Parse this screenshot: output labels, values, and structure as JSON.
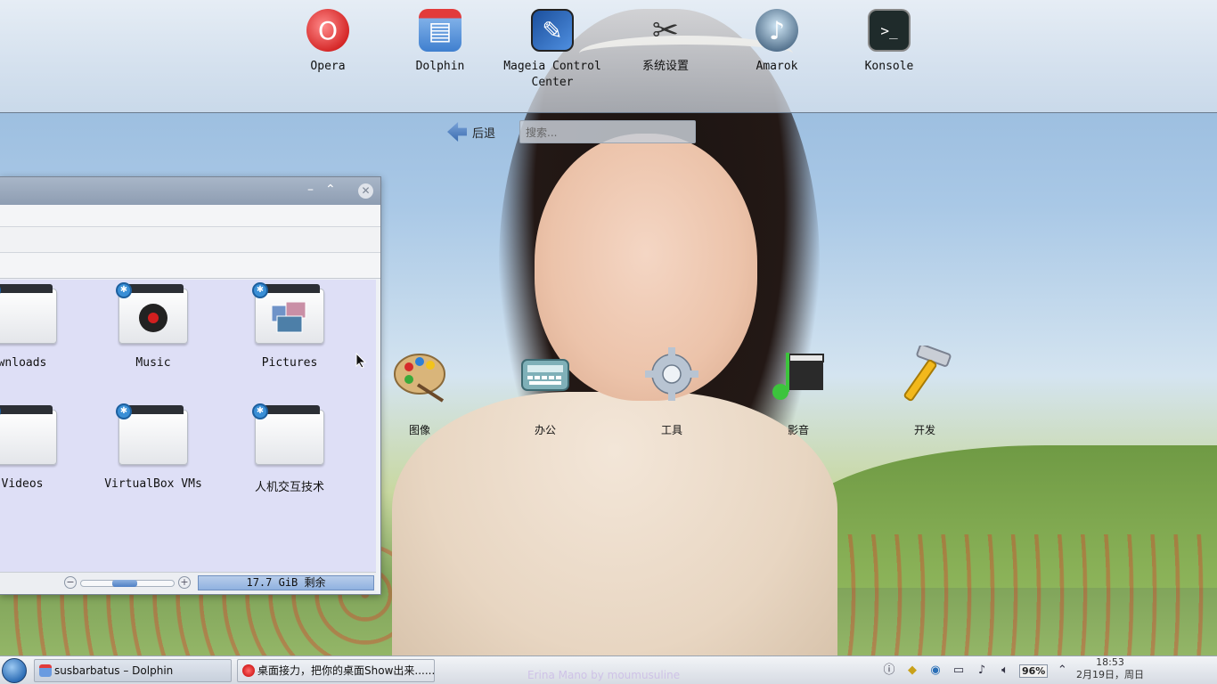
{
  "launcher": {
    "apps": [
      {
        "label": "Opera",
        "icon": "opera-icon"
      },
      {
        "label": "Dolphin",
        "icon": "dolphin-icon"
      },
      {
        "label": "Mageia Control Center",
        "icon": "control-center-icon"
      },
      {
        "label": "系统设置",
        "icon": "system-settings-icon"
      },
      {
        "label": "Amarok",
        "icon": "amarok-icon"
      },
      {
        "label": "Konsole",
        "icon": "konsole-icon"
      }
    ],
    "back_label": "后退",
    "search_placeholder": "搜索..."
  },
  "categories": [
    {
      "label": "图像",
      "icon": "palette-icon"
    },
    {
      "label": "办公",
      "icon": "typewriter-icon"
    },
    {
      "label": "工具",
      "icon": "gear-icon"
    },
    {
      "label": "影音",
      "icon": "music-clapper-icon"
    },
    {
      "label": "开发",
      "icon": "hammer-icon"
    }
  ],
  "dolphin": {
    "files": [
      {
        "label": "wnloads"
      },
      {
        "label": "Music"
      },
      {
        "label": "Pictures"
      },
      {
        "label": "Videos"
      },
      {
        "label": "VirtualBox VMs"
      },
      {
        "label": "人机交互技术"
      }
    ],
    "free_space": "17.7 GiB 剩余",
    "zoom_level": 0.45
  },
  "taskbar": {
    "tasks": [
      {
        "label": "susbarbatus – Dolphin"
      },
      {
        "label": "桌面接力，把你的桌面Show出来......"
      }
    ],
    "watermark": "Erina Mano by moumusuline",
    "battery": "96%",
    "time": "18:53",
    "date": "2月19日，周日"
  },
  "colors": {
    "file_area_bg": "#dedff6",
    "title_bar": "#9aa9bd",
    "accent_blue": "#3a8fd6"
  }
}
